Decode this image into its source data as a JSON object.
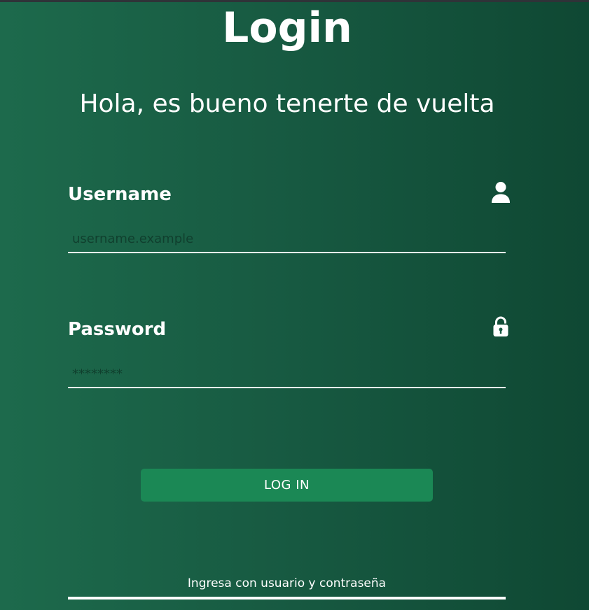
{
  "header": {
    "title": "Login",
    "subtitle": "Hola, es bueno tenerte de vuelta"
  },
  "form": {
    "username": {
      "label": "Username",
      "placeholder": "username.example",
      "value": "",
      "icon": "user-icon"
    },
    "password": {
      "label": "Password",
      "placeholder": "********",
      "value": "",
      "icon": "lock-icon"
    },
    "submit_label": "LOG IN"
  },
  "footer": {
    "hint": "Ingresa con usuario y contraseña"
  },
  "colors": {
    "background_start": "#1d6a4c",
    "background_end": "#0f4833",
    "button": "#1b8855",
    "text": "#ffffff"
  }
}
